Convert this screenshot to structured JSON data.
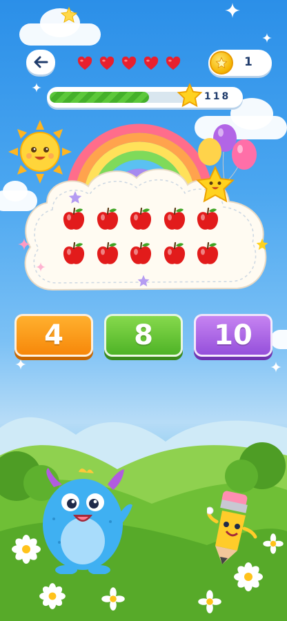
{
  "topbar": {
    "back_icon": "arrow-left-icon",
    "lives_total": 5,
    "lives_remaining": 5,
    "coin_count": "1"
  },
  "progress": {
    "fraction": 0.72,
    "score": "118"
  },
  "question": {
    "apple_count": 10,
    "rows": 2,
    "per_row": 5
  },
  "answers": {
    "option_1": "4",
    "option_2": "8",
    "option_3": "10"
  },
  "colors": {
    "heart": "#e8202e",
    "apple": "#e21b1b",
    "option_1": "#f7880a",
    "option_2": "#4fb327",
    "option_3": "#9550db"
  }
}
